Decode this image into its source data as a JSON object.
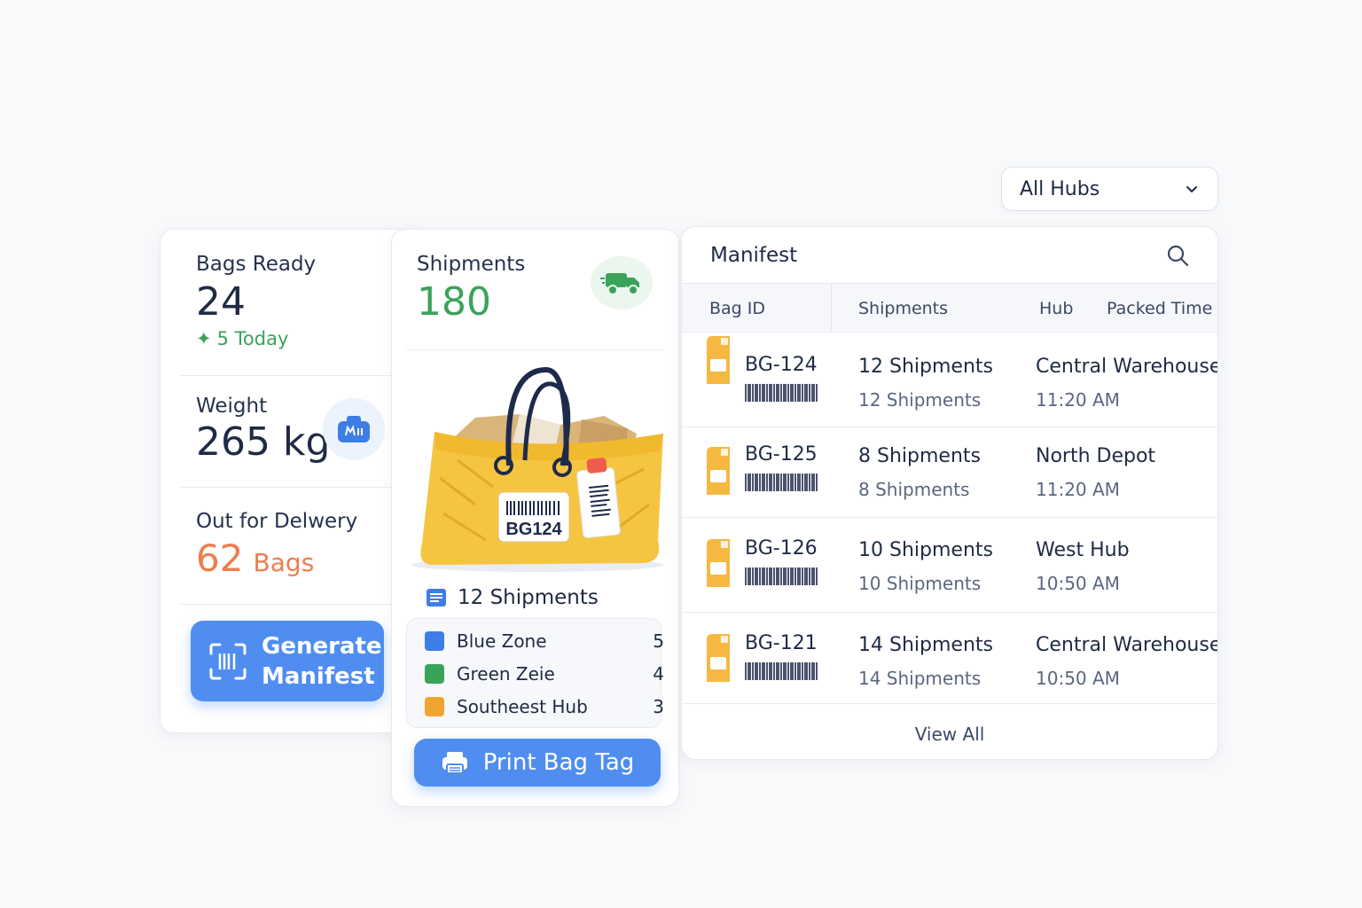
{
  "filter": {
    "hub_selected": "All Hubs"
  },
  "stats": {
    "bags_ready": {
      "label": "Bags Ready",
      "value": "24",
      "delta": "5 Today"
    },
    "weight": {
      "label": "Weight",
      "value": "265 kg"
    },
    "out_for_delivery": {
      "label": "Out for Delwery",
      "value": "62",
      "unit": "Bags"
    },
    "generate_line1": "Generate",
    "generate_line2": "Manifest"
  },
  "shipments_card": {
    "label": "Shipments",
    "value": "180",
    "bag_tag_text": "BG124",
    "bag_shipments": "12 Shipments",
    "zones": [
      {
        "name": "Blue Zone",
        "count": "5",
        "color": "#3f7de6"
      },
      {
        "name": "Green Zeie",
        "count": "4",
        "color": "#3aa35a"
      },
      {
        "name": "Southeest Hub",
        "count": "3",
        "color": "#f0a531"
      }
    ],
    "print_label": "Print Bag Tag"
  },
  "manifest": {
    "title": "Manifest",
    "columns": [
      "Bag ID",
      "Shipments",
      "Hub",
      "Packed Time"
    ],
    "rows": [
      {
        "bag_id": "BG-124",
        "shipments": "12 Shipments",
        "shipments_sub": "12 Shipments",
        "hub": "Central Warehouse",
        "time": "11:20 AM"
      },
      {
        "bag_id": "BG-125",
        "shipments": "8 Shipments",
        "shipments_sub": "8 Shipments",
        "hub": "North Depot",
        "time": "11:20 AM"
      },
      {
        "bag_id": "BG-126",
        "shipments": "10 Shipments",
        "shipments_sub": "10 Shipments",
        "hub": "West Hub",
        "time": "10:50 AM"
      },
      {
        "bag_id": "BG-121",
        "shipments": "14 Shipments",
        "shipments_sub": "14 Shipments",
        "hub": "Central Warehouse",
        "time": "10:50 AM"
      }
    ],
    "view_all": "View All"
  },
  "colors": {
    "accent": "#4f8ef0",
    "green": "#3aa35a",
    "orange": "#ef7d4d",
    "bag_yellow": "#f5c542"
  }
}
